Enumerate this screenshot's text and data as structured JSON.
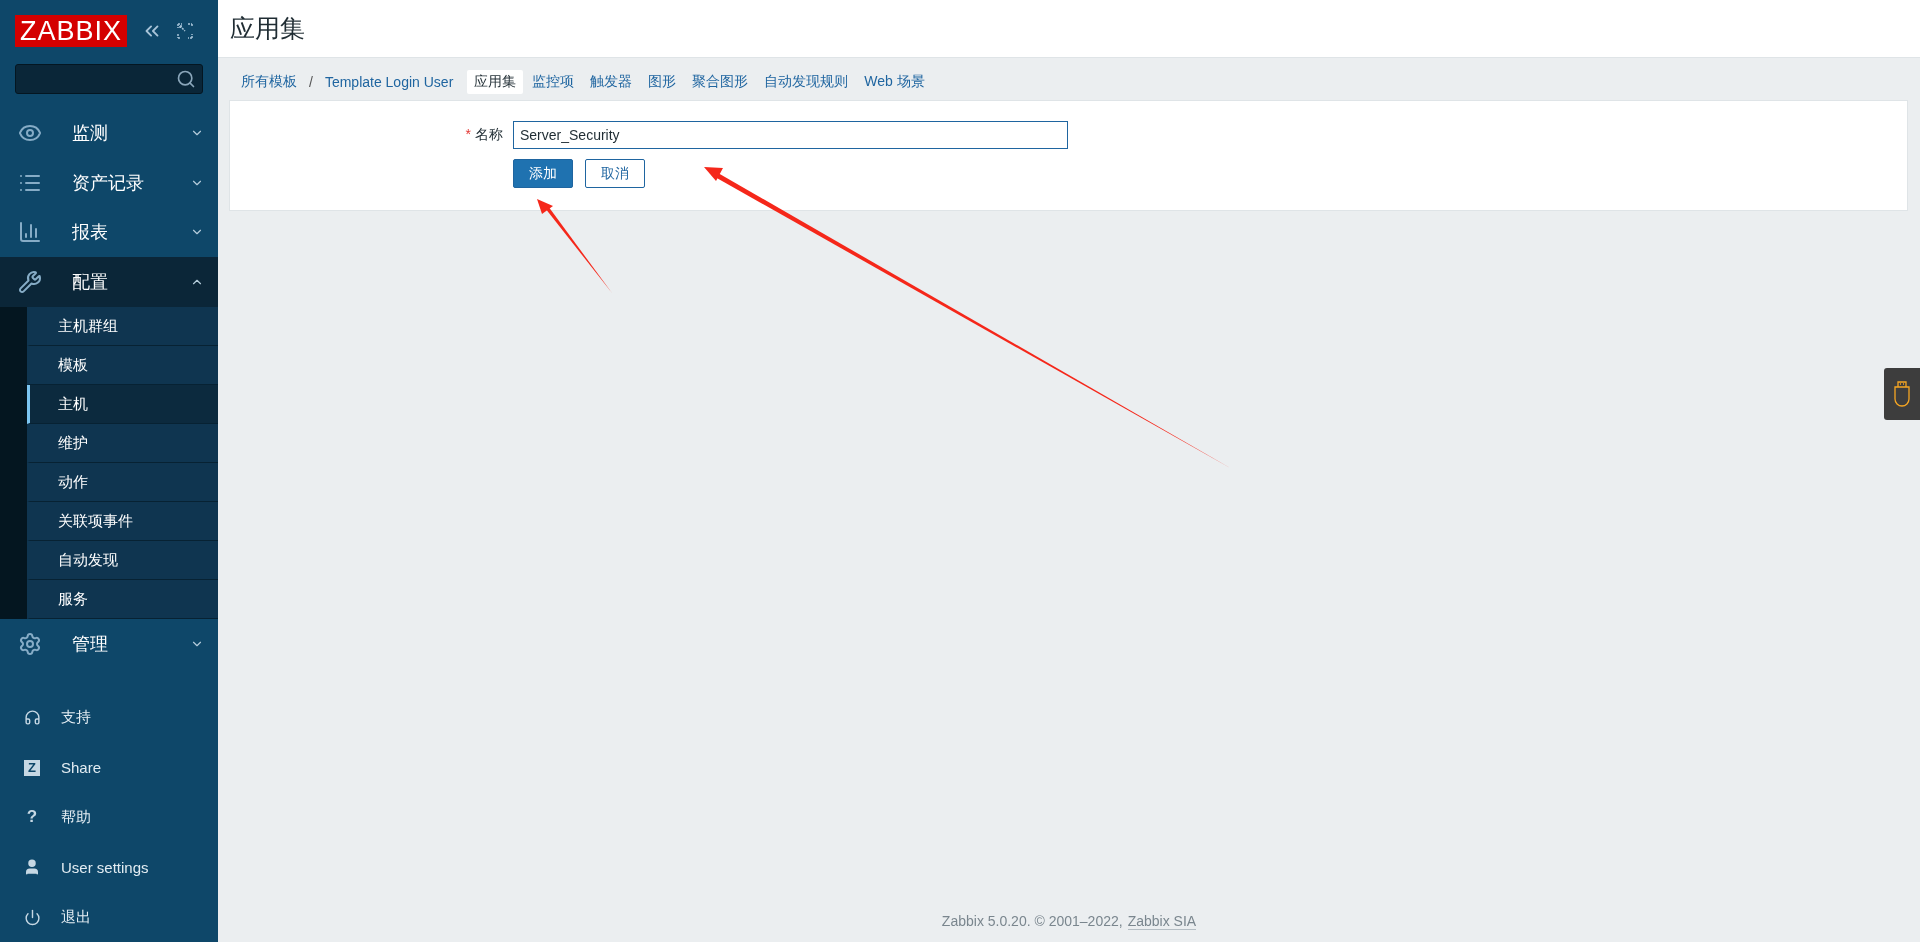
{
  "sidebar": {
    "logo": "ZABBIX",
    "sections": [
      {
        "kind": "monitoring",
        "label": "监测",
        "expanded": false
      },
      {
        "kind": "inventory",
        "label": "资产记录",
        "expanded": false
      },
      {
        "kind": "reports",
        "label": "报表",
        "expanded": false
      },
      {
        "kind": "configuration",
        "label": "配置",
        "expanded": true,
        "children": [
          {
            "label": "主机群组",
            "selected": false
          },
          {
            "label": "模板",
            "selected": false
          },
          {
            "label": "主机",
            "selected": true
          },
          {
            "label": "维护",
            "selected": false
          },
          {
            "label": "动作",
            "selected": false
          },
          {
            "label": "关联项事件",
            "selected": false
          },
          {
            "label": "自动发现",
            "selected": false
          },
          {
            "label": "服务",
            "selected": false
          }
        ]
      },
      {
        "kind": "administration",
        "label": "管理",
        "expanded": false
      }
    ],
    "links": [
      {
        "kind": "support",
        "label": "支持"
      },
      {
        "kind": "share",
        "label": "Share",
        "glyph": "Z"
      },
      {
        "kind": "help",
        "label": "帮助",
        "glyph": "?"
      },
      {
        "kind": "user",
        "label": "User settings"
      },
      {
        "kind": "logout",
        "label": "退出"
      }
    ]
  },
  "header": {
    "title": "应用集"
  },
  "breadcrumbs": [
    "所有模板",
    "/",
    "Template Login User"
  ],
  "tabs": [
    {
      "label": "应用集",
      "selected": true
    },
    {
      "label": "监控项",
      "selected": false
    },
    {
      "label": "触发器",
      "selected": false
    },
    {
      "label": "图形",
      "selected": false
    },
    {
      "label": "聚合图形",
      "selected": false
    },
    {
      "label": "自动发现规则",
      "selected": false
    },
    {
      "label": "Web 场景",
      "selected": false
    }
  ],
  "form": {
    "fields": [
      {
        "label": "名称",
        "required": true,
        "mark": "*",
        "value": "Server_Security"
      }
    ],
    "buttons": [
      {
        "kind": "primary",
        "label": "添加"
      },
      {
        "kind": "secondary",
        "label": "取消"
      }
    ]
  },
  "footer": {
    "text": "Zabbix 5.0.20. © 2001–2022,",
    "link": "Zabbix SIA"
  }
}
